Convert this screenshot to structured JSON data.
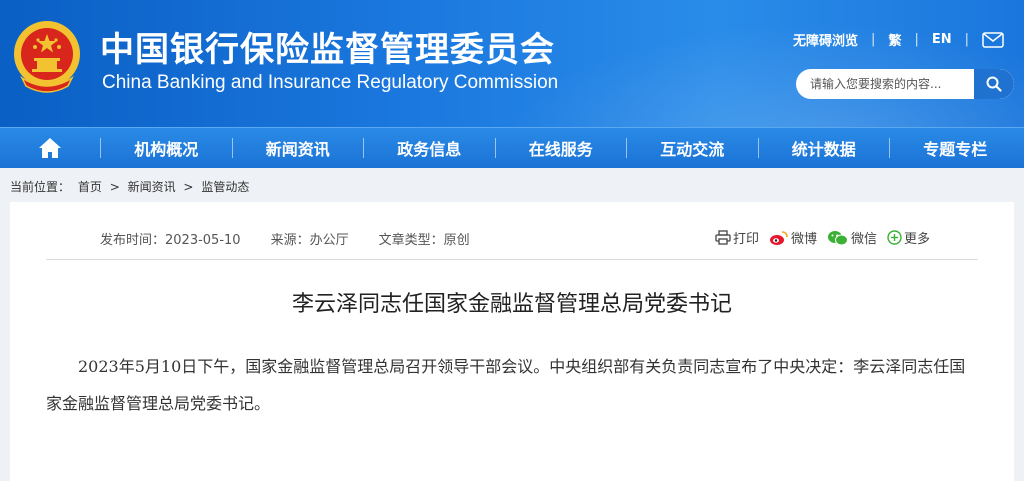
{
  "header": {
    "title_cn": "中国银行保险监督管理委员会",
    "title_en": "China Banking and Insurance Regulatory Commission",
    "links": [
      "无障碍浏览",
      "繁",
      "EN"
    ],
    "search_placeholder": "请输入您要搜索的内容..."
  },
  "nav": {
    "items": [
      "机构概况",
      "新闻资讯",
      "政务信息",
      "在线服务",
      "互动交流",
      "统计数据",
      "专题专栏"
    ]
  },
  "breadcrumb": {
    "prefix": "当前位置：",
    "items": [
      "首页",
      "新闻资讯",
      "监管动态"
    ],
    "sep": ">"
  },
  "article": {
    "publish_time": "发布时间：2023-05-10",
    "source": "来源：办公厅",
    "type": "文章类型：原创",
    "share": {
      "print": "打印",
      "weibo": "微博",
      "wechat": "微信",
      "more": "更多"
    },
    "title": "李云泽同志任国家金融监督管理总局党委书记",
    "paragraph": "2023年5月10日下午，国家金融监督管理总局召开领导干部会议。中央组织部有关负责同志宣布了中央决定：李云泽同志任国家金融监督管理总局党委书记。"
  },
  "colors": {
    "header_blue": "#1b78de",
    "nav_blue": "#1f7ad9",
    "emblem_red": "#d8261c",
    "emblem_gold": "#f2c230"
  }
}
